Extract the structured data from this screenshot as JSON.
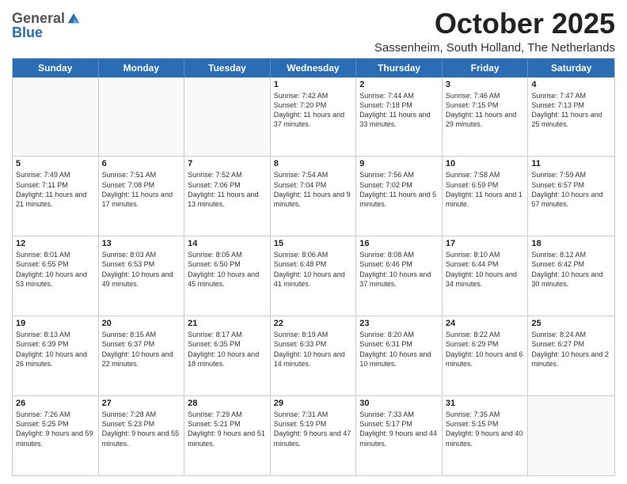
{
  "logo": {
    "general": "General",
    "blue": "Blue"
  },
  "header": {
    "month": "October 2025",
    "location": "Sassenheim, South Holland, The Netherlands"
  },
  "weekdays": [
    "Sunday",
    "Monday",
    "Tuesday",
    "Wednesday",
    "Thursday",
    "Friday",
    "Saturday"
  ],
  "rows": [
    [
      {
        "day": "",
        "sunrise": "",
        "sunset": "",
        "daylight": ""
      },
      {
        "day": "",
        "sunrise": "",
        "sunset": "",
        "daylight": ""
      },
      {
        "day": "",
        "sunrise": "",
        "sunset": "",
        "daylight": ""
      },
      {
        "day": "1",
        "sunrise": "Sunrise: 7:42 AM",
        "sunset": "Sunset: 7:20 PM",
        "daylight": "Daylight: 11 hours and 37 minutes."
      },
      {
        "day": "2",
        "sunrise": "Sunrise: 7:44 AM",
        "sunset": "Sunset: 7:18 PM",
        "daylight": "Daylight: 11 hours and 33 minutes."
      },
      {
        "day": "3",
        "sunrise": "Sunrise: 7:46 AM",
        "sunset": "Sunset: 7:15 PM",
        "daylight": "Daylight: 11 hours and 29 minutes."
      },
      {
        "day": "4",
        "sunrise": "Sunrise: 7:47 AM",
        "sunset": "Sunset: 7:13 PM",
        "daylight": "Daylight: 11 hours and 25 minutes."
      }
    ],
    [
      {
        "day": "5",
        "sunrise": "Sunrise: 7:49 AM",
        "sunset": "Sunset: 7:11 PM",
        "daylight": "Daylight: 11 hours and 21 minutes."
      },
      {
        "day": "6",
        "sunrise": "Sunrise: 7:51 AM",
        "sunset": "Sunset: 7:08 PM",
        "daylight": "Daylight: 11 hours and 17 minutes."
      },
      {
        "day": "7",
        "sunrise": "Sunrise: 7:52 AM",
        "sunset": "Sunset: 7:06 PM",
        "daylight": "Daylight: 11 hours and 13 minutes."
      },
      {
        "day": "8",
        "sunrise": "Sunrise: 7:54 AM",
        "sunset": "Sunset: 7:04 PM",
        "daylight": "Daylight: 11 hours and 9 minutes."
      },
      {
        "day": "9",
        "sunrise": "Sunrise: 7:56 AM",
        "sunset": "Sunset: 7:02 PM",
        "daylight": "Daylight: 11 hours and 5 minutes."
      },
      {
        "day": "10",
        "sunrise": "Sunrise: 7:58 AM",
        "sunset": "Sunset: 6:59 PM",
        "daylight": "Daylight: 11 hours and 1 minute."
      },
      {
        "day": "11",
        "sunrise": "Sunrise: 7:59 AM",
        "sunset": "Sunset: 6:57 PM",
        "daylight": "Daylight: 10 hours and 57 minutes."
      }
    ],
    [
      {
        "day": "12",
        "sunrise": "Sunrise: 8:01 AM",
        "sunset": "Sunset: 6:55 PM",
        "daylight": "Daylight: 10 hours and 53 minutes."
      },
      {
        "day": "13",
        "sunrise": "Sunrise: 8:03 AM",
        "sunset": "Sunset: 6:53 PM",
        "daylight": "Daylight: 10 hours and 49 minutes."
      },
      {
        "day": "14",
        "sunrise": "Sunrise: 8:05 AM",
        "sunset": "Sunset: 6:50 PM",
        "daylight": "Daylight: 10 hours and 45 minutes."
      },
      {
        "day": "15",
        "sunrise": "Sunrise: 8:06 AM",
        "sunset": "Sunset: 6:48 PM",
        "daylight": "Daylight: 10 hours and 41 minutes."
      },
      {
        "day": "16",
        "sunrise": "Sunrise: 8:08 AM",
        "sunset": "Sunset: 6:46 PM",
        "daylight": "Daylight: 10 hours and 37 minutes."
      },
      {
        "day": "17",
        "sunrise": "Sunrise: 8:10 AM",
        "sunset": "Sunset: 6:44 PM",
        "daylight": "Daylight: 10 hours and 34 minutes."
      },
      {
        "day": "18",
        "sunrise": "Sunrise: 8:12 AM",
        "sunset": "Sunset: 6:42 PM",
        "daylight": "Daylight: 10 hours and 30 minutes."
      }
    ],
    [
      {
        "day": "19",
        "sunrise": "Sunrise: 8:13 AM",
        "sunset": "Sunset: 6:39 PM",
        "daylight": "Daylight: 10 hours and 26 minutes."
      },
      {
        "day": "20",
        "sunrise": "Sunrise: 8:15 AM",
        "sunset": "Sunset: 6:37 PM",
        "daylight": "Daylight: 10 hours and 22 minutes."
      },
      {
        "day": "21",
        "sunrise": "Sunrise: 8:17 AM",
        "sunset": "Sunset: 6:35 PM",
        "daylight": "Daylight: 10 hours and 18 minutes."
      },
      {
        "day": "22",
        "sunrise": "Sunrise: 8:19 AM",
        "sunset": "Sunset: 6:33 PM",
        "daylight": "Daylight: 10 hours and 14 minutes."
      },
      {
        "day": "23",
        "sunrise": "Sunrise: 8:20 AM",
        "sunset": "Sunset: 6:31 PM",
        "daylight": "Daylight: 10 hours and 10 minutes."
      },
      {
        "day": "24",
        "sunrise": "Sunrise: 8:22 AM",
        "sunset": "Sunset: 6:29 PM",
        "daylight": "Daylight: 10 hours and 6 minutes."
      },
      {
        "day": "25",
        "sunrise": "Sunrise: 8:24 AM",
        "sunset": "Sunset: 6:27 PM",
        "daylight": "Daylight: 10 hours and 2 minutes."
      }
    ],
    [
      {
        "day": "26",
        "sunrise": "Sunrise: 7:26 AM",
        "sunset": "Sunset: 5:25 PM",
        "daylight": "Daylight: 9 hours and 59 minutes."
      },
      {
        "day": "27",
        "sunrise": "Sunrise: 7:28 AM",
        "sunset": "Sunset: 5:23 PM",
        "daylight": "Daylight: 9 hours and 55 minutes."
      },
      {
        "day": "28",
        "sunrise": "Sunrise: 7:29 AM",
        "sunset": "Sunset: 5:21 PM",
        "daylight": "Daylight: 9 hours and 51 minutes."
      },
      {
        "day": "29",
        "sunrise": "Sunrise: 7:31 AM",
        "sunset": "Sunset: 5:19 PM",
        "daylight": "Daylight: 9 hours and 47 minutes."
      },
      {
        "day": "30",
        "sunrise": "Sunrise: 7:33 AM",
        "sunset": "Sunset: 5:17 PM",
        "daylight": "Daylight: 9 hours and 44 minutes."
      },
      {
        "day": "31",
        "sunrise": "Sunrise: 7:35 AM",
        "sunset": "Sunset: 5:15 PM",
        "daylight": "Daylight: 9 hours and 40 minutes."
      },
      {
        "day": "",
        "sunrise": "",
        "sunset": "",
        "daylight": ""
      }
    ]
  ]
}
